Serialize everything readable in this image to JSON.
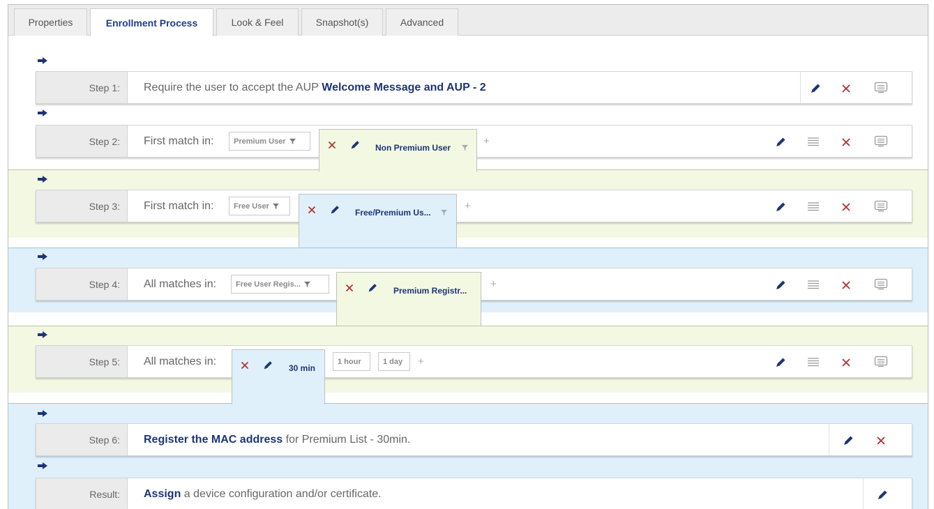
{
  "tabs": [
    {
      "label": "Properties",
      "active": false
    },
    {
      "label": "Enrollment Process",
      "active": true
    },
    {
      "label": "Look & Feel",
      "active": false
    },
    {
      "label": "Snapshot(s)",
      "active": false
    },
    {
      "label": "Advanced",
      "active": false
    }
  ],
  "steps": {
    "step1": {
      "label": "Step 1:",
      "text_prefix": "Require the user to accept the AUP",
      "text_bold": "Welcome Message and AUP - 2"
    },
    "step2": {
      "label": "Step 2:",
      "prefix": "First match in:",
      "chips": [
        "Premium User"
      ],
      "selected": "Non Premium User"
    },
    "step3": {
      "label": "Step 3:",
      "prefix": "First match in:",
      "chips": [
        "Free User"
      ],
      "selected": "Free/Premium Us..."
    },
    "step4": {
      "label": "Step 4:",
      "prefix": "All matches in:",
      "chips": [
        "Free User Regis..."
      ],
      "selected": "Premium Registr..."
    },
    "step5": {
      "label": "Step 5:",
      "prefix": "All matches in:",
      "selected": "30 min",
      "chips": [
        "1 hour",
        "1 day"
      ]
    },
    "step6": {
      "label": "Step 6:",
      "text_bold": "Register the MAC address",
      "text_suffix": "for Premium List - 30min."
    },
    "result": {
      "label": "Result:",
      "text_bold": "Assign",
      "text_suffix": "a device configuration and/or certificate."
    }
  },
  "add_symbol": "+",
  "colors": {
    "navy": "#1d3575",
    "delete_red": "#b03030",
    "green_band": "#f3f8e2",
    "blue_band": "#dff0fb"
  },
  "icons": [
    "arrow-right-icon",
    "pencil-icon",
    "x-icon",
    "list-icon",
    "comment-icon",
    "filter-icon"
  ]
}
